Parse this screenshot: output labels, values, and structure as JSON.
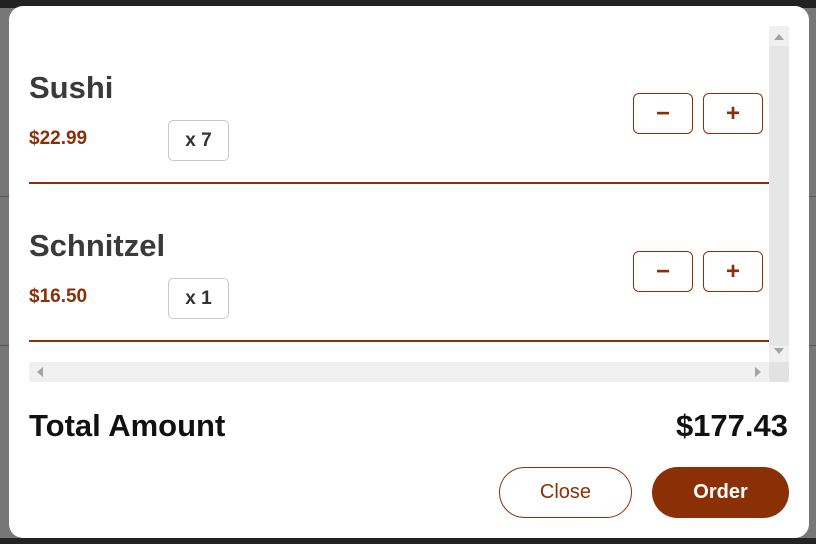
{
  "cart": {
    "items": [
      {
        "name": "Sushi",
        "price": "$22.99",
        "quantity": "x 7",
        "decrement_label": "−",
        "increment_label": "+"
      },
      {
        "name": "Schnitzel",
        "price": "$16.50",
        "quantity": "x 1",
        "decrement_label": "−",
        "increment_label": "+"
      }
    ],
    "total_label": "Total Amount",
    "total_value": "$177.43"
  },
  "actions": {
    "close_label": "Close",
    "order_label": "Order"
  },
  "colors": {
    "accent": "#8b2f06",
    "text_dark": "#3a3a3a"
  },
  "icons": {
    "scroll_up": "arrow-up-icon",
    "scroll_down": "arrow-down-icon",
    "scroll_left": "arrow-left-icon",
    "scroll_right": "arrow-right-icon"
  }
}
